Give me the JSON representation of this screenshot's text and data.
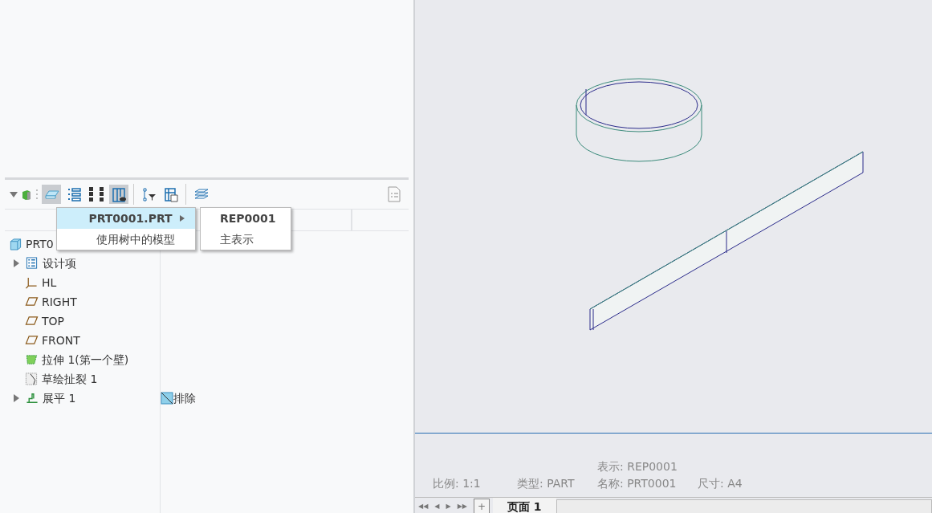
{
  "model_tree": {
    "header_columns": [
      "",
      ""
    ],
    "items": [
      {
        "label": "PRT0",
        "kind": "part",
        "expandable": false
      },
      {
        "label": "设计项",
        "kind": "design",
        "expandable": true
      },
      {
        "label": "HL",
        "kind": "csys",
        "expandable": false
      },
      {
        "label": "RIGHT",
        "kind": "plane",
        "expandable": false
      },
      {
        "label": "TOP",
        "kind": "plane",
        "expandable": false
      },
      {
        "label": "FRONT",
        "kind": "plane",
        "expandable": false
      },
      {
        "label": "拉伸 1(第一个壁)",
        "kind": "wall",
        "expandable": false
      },
      {
        "label": "草绘扯裂 1",
        "kind": "rip",
        "expandable": false
      },
      {
        "label": "展平 1",
        "kind": "flatten",
        "expandable": true,
        "column_2": "排除"
      }
    ]
  },
  "context_menu": {
    "items": [
      {
        "label": "PRT0001.PRT",
        "selected": true,
        "submenu": true
      },
      {
        "label": "使用树中的模型",
        "selected": false,
        "submenu": false
      }
    ],
    "submenu": [
      {
        "label": "REP0001",
        "bold": true
      },
      {
        "label": "主表示",
        "bold": false
      }
    ]
  },
  "status": {
    "scale": "比例: 1:1",
    "type": "类型: PART",
    "representation": "表示: REP0001",
    "name": "名称: PRT0001",
    "size": "尺寸: A4"
  },
  "page_nav": {
    "buttons": [
      "◀◀",
      "◀",
      "▶",
      "▶▶",
      "+"
    ],
    "tabs": [
      {
        "label": "页面 1",
        "selected": true
      }
    ]
  }
}
